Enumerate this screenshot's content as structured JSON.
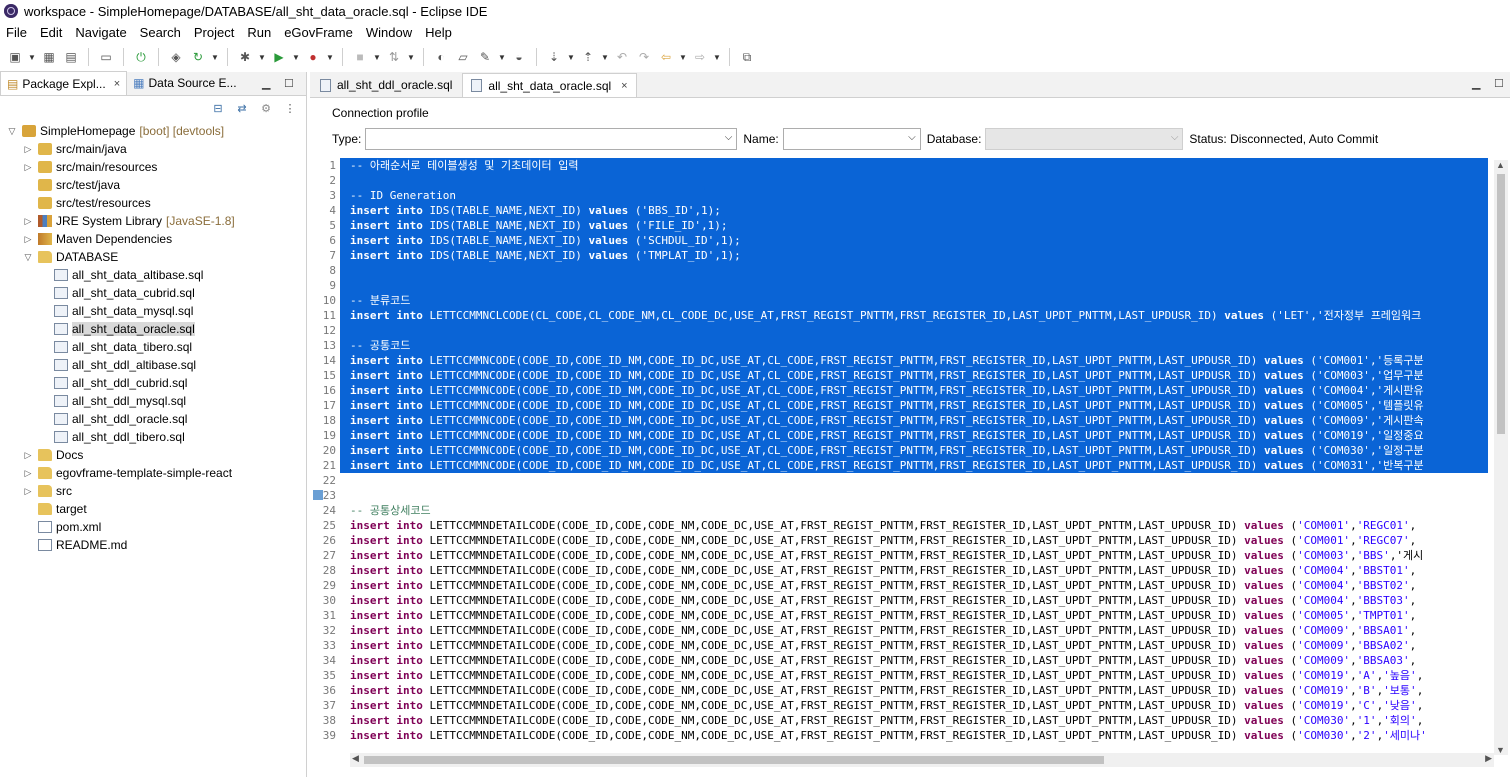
{
  "window": {
    "title": "workspace - SimpleHomepage/DATABASE/all_sht_data_oracle.sql - Eclipse IDE"
  },
  "menu": [
    "File",
    "Edit",
    "Navigate",
    "Search",
    "Project",
    "Run",
    "eGovFrame",
    "Window",
    "Help"
  ],
  "left_panel": {
    "tabs": [
      {
        "label": "Package Expl...",
        "close": "×"
      },
      {
        "label": "Data Source E..."
      }
    ],
    "tree": [
      {
        "label": "SimpleHomepage",
        "decoration": "[boot] [devtools]"
      },
      {
        "label": "src/main/java"
      },
      {
        "label": "src/main/resources"
      },
      {
        "label": "src/test/java"
      },
      {
        "label": "src/test/resources"
      },
      {
        "label": "JRE System Library",
        "decoration": "[JavaSE-1.8]"
      },
      {
        "label": "Maven Dependencies"
      },
      {
        "label": "DATABASE"
      },
      {
        "label": "all_sht_data_altibase.sql"
      },
      {
        "label": "all_sht_data_cubrid.sql"
      },
      {
        "label": "all_sht_data_mysql.sql"
      },
      {
        "label": "all_sht_data_oracle.sql"
      },
      {
        "label": "all_sht_data_tibero.sql"
      },
      {
        "label": "all_sht_ddl_altibase.sql"
      },
      {
        "label": "all_sht_ddl_cubrid.sql"
      },
      {
        "label": "all_sht_ddl_mysql.sql"
      },
      {
        "label": "all_sht_ddl_oracle.sql"
      },
      {
        "label": "all_sht_ddl_tibero.sql"
      },
      {
        "label": "Docs"
      },
      {
        "label": "egovframe-template-simple-react"
      },
      {
        "label": "src"
      },
      {
        "label": "target"
      },
      {
        "label": "pom.xml"
      },
      {
        "label": "README.md"
      }
    ]
  },
  "editor": {
    "tabs": [
      {
        "label": "all_sht_ddl_oracle.sql"
      },
      {
        "label": "all_sht_data_oracle.sql",
        "close": "×"
      }
    ],
    "connection_profile": {
      "legend": "Connection profile",
      "type_label": "Type:",
      "name_label": "Name:",
      "database_label": "Database:",
      "status": "Status: Disconnected, Auto Commit"
    },
    "lines": [
      {
        "n": "1",
        "text": "-- 아래순서로 테이블생성 및 기초데이터 입력"
      },
      {
        "n": "2",
        "text": ""
      },
      {
        "n": "3",
        "text": "-- ID Generation"
      },
      {
        "n": "4",
        "text": "insert into IDS(TABLE_NAME,NEXT_ID) values ('BBS_ID',1);"
      },
      {
        "n": "5",
        "text": "insert into IDS(TABLE_NAME,NEXT_ID) values ('FILE_ID',1);"
      },
      {
        "n": "6",
        "text": "insert into IDS(TABLE_NAME,NEXT_ID) values ('SCHDUL_ID',1);"
      },
      {
        "n": "7",
        "text": "insert into IDS(TABLE_NAME,NEXT_ID) values ('TMPLAT_ID',1);"
      },
      {
        "n": "8",
        "text": ""
      },
      {
        "n": "9",
        "text": ""
      },
      {
        "n": "10",
        "text": "-- 분류코드"
      },
      {
        "n": "11",
        "text": "insert into LETTCCMMNCLCODE(CL_CODE,CL_CODE_NM,CL_CODE_DC,USE_AT,FRST_REGIST_PNTTM,FRST_REGISTER_ID,LAST_UPDT_PNTTM,LAST_UPDUSR_ID) values ('LET','전자정부 프레임워크"
      },
      {
        "n": "12",
        "text": ""
      },
      {
        "n": "13",
        "text": "-- 공통코드"
      },
      {
        "n": "14",
        "text": "insert into LETTCCMMNCODE(CODE_ID,CODE_ID_NM,CODE_ID_DC,USE_AT,CL_CODE,FRST_REGIST_PNTTM,FRST_REGISTER_ID,LAST_UPDT_PNTTM,LAST_UPDUSR_ID) values ('COM001','등록구분"
      },
      {
        "n": "15",
        "text": "insert into LETTCCMMNCODE(CODE_ID,CODE_ID_NM,CODE_ID_DC,USE_AT,CL_CODE,FRST_REGIST_PNTTM,FRST_REGISTER_ID,LAST_UPDT_PNTTM,LAST_UPDUSR_ID) values ('COM003','업무구분"
      },
      {
        "n": "16",
        "text": "insert into LETTCCMMNCODE(CODE_ID,CODE_ID_NM,CODE_ID_DC,USE_AT,CL_CODE,FRST_REGIST_PNTTM,FRST_REGISTER_ID,LAST_UPDT_PNTTM,LAST_UPDUSR_ID) values ('COM004','게시판유"
      },
      {
        "n": "17",
        "text": "insert into LETTCCMMNCODE(CODE_ID,CODE_ID_NM,CODE_ID_DC,USE_AT,CL_CODE,FRST_REGIST_PNTTM,FRST_REGISTER_ID,LAST_UPDT_PNTTM,LAST_UPDUSR_ID) values ('COM005','템플릿유"
      },
      {
        "n": "18",
        "text": "insert into LETTCCMMNCODE(CODE_ID,CODE_ID_NM,CODE_ID_DC,USE_AT,CL_CODE,FRST_REGIST_PNTTM,FRST_REGISTER_ID,LAST_UPDT_PNTTM,LAST_UPDUSR_ID) values ('COM009','게시판속"
      },
      {
        "n": "19",
        "text": "insert into LETTCCMMNCODE(CODE_ID,CODE_ID_NM,CODE_ID_DC,USE_AT,CL_CODE,FRST_REGIST_PNTTM,FRST_REGISTER_ID,LAST_UPDT_PNTTM,LAST_UPDUSR_ID) values ('COM019','일정중요"
      },
      {
        "n": "20",
        "text": "insert into LETTCCMMNCODE(CODE_ID,CODE_ID_NM,CODE_ID_DC,USE_AT,CL_CODE,FRST_REGIST_PNTTM,FRST_REGISTER_ID,LAST_UPDT_PNTTM,LAST_UPDUSR_ID) values ('COM030','일정구분"
      },
      {
        "n": "21",
        "text": "insert into LETTCCMMNCODE(CODE_ID,CODE_ID_NM,CODE_ID_DC,USE_AT,CL_CODE,FRST_REGIST_PNTTM,FRST_REGISTER_ID,LAST_UPDT_PNTTM,LAST_UPDUSR_ID) values ('COM031','반복구분"
      },
      {
        "n": "22",
        "text": ""
      },
      {
        "n": "23",
        "text": ""
      },
      {
        "n": "24",
        "text": "-- 공통상세코드"
      },
      {
        "n": "25",
        "text": "insert into LETTCCMMNDETAILCODE(CODE_ID,CODE,CODE_NM,CODE_DC,USE_AT,FRST_REGIST_PNTTM,FRST_REGISTER_ID,LAST_UPDT_PNTTM,LAST_UPDUSR_ID) values ('COM001','REGC01',"
      },
      {
        "n": "26",
        "text": "insert into LETTCCMMNDETAILCODE(CODE_ID,CODE,CODE_NM,CODE_DC,USE_AT,FRST_REGIST_PNTTM,FRST_REGISTER_ID,LAST_UPDT_PNTTM,LAST_UPDUSR_ID) values ('COM001','REGC07',"
      },
      {
        "n": "27",
        "text": "insert into LETTCCMMNDETAILCODE(CODE_ID,CODE,CODE_NM,CODE_DC,USE_AT,FRST_REGIST_PNTTM,FRST_REGISTER_ID,LAST_UPDT_PNTTM,LAST_UPDUSR_ID) values ('COM003','BBS','게시"
      },
      {
        "n": "28",
        "text": "insert into LETTCCMMNDETAILCODE(CODE_ID,CODE,CODE_NM,CODE_DC,USE_AT,FRST_REGIST_PNTTM,FRST_REGISTER_ID,LAST_UPDT_PNTTM,LAST_UPDUSR_ID) values ('COM004','BBST01',"
      },
      {
        "n": "29",
        "text": "insert into LETTCCMMNDETAILCODE(CODE_ID,CODE,CODE_NM,CODE_DC,USE_AT,FRST_REGIST_PNTTM,FRST_REGISTER_ID,LAST_UPDT_PNTTM,LAST_UPDUSR_ID) values ('COM004','BBST02',"
      },
      {
        "n": "30",
        "text": "insert into LETTCCMMNDETAILCODE(CODE_ID,CODE,CODE_NM,CODE_DC,USE_AT,FRST_REGIST_PNTTM,FRST_REGISTER_ID,LAST_UPDT_PNTTM,LAST_UPDUSR_ID) values ('COM004','BBST03',"
      },
      {
        "n": "31",
        "text": "insert into LETTCCMMNDETAILCODE(CODE_ID,CODE,CODE_NM,CODE_DC,USE_AT,FRST_REGIST_PNTTM,FRST_REGISTER_ID,LAST_UPDT_PNTTM,LAST_UPDUSR_ID) values ('COM005','TMPT01',"
      },
      {
        "n": "32",
        "text": "insert into LETTCCMMNDETAILCODE(CODE_ID,CODE,CODE_NM,CODE_DC,USE_AT,FRST_REGIST_PNTTM,FRST_REGISTER_ID,LAST_UPDT_PNTTM,LAST_UPDUSR_ID) values ('COM009','BBSA01',"
      },
      {
        "n": "33",
        "text": "insert into LETTCCMMNDETAILCODE(CODE_ID,CODE,CODE_NM,CODE_DC,USE_AT,FRST_REGIST_PNTTM,FRST_REGISTER_ID,LAST_UPDT_PNTTM,LAST_UPDUSR_ID) values ('COM009','BBSA02',"
      },
      {
        "n": "34",
        "text": "insert into LETTCCMMNDETAILCODE(CODE_ID,CODE,CODE_NM,CODE_DC,USE_AT,FRST_REGIST_PNTTM,FRST_REGISTER_ID,LAST_UPDT_PNTTM,LAST_UPDUSR_ID) values ('COM009','BBSA03',"
      },
      {
        "n": "35",
        "text": "insert into LETTCCMMNDETAILCODE(CODE_ID,CODE,CODE_NM,CODE_DC,USE_AT,FRST_REGIST_PNTTM,FRST_REGISTER_ID,LAST_UPDT_PNTTM,LAST_UPDUSR_ID) values ('COM019','A','높음',"
      },
      {
        "n": "36",
        "text": "insert into LETTCCMMNDETAILCODE(CODE_ID,CODE,CODE_NM,CODE_DC,USE_AT,FRST_REGIST_PNTTM,FRST_REGISTER_ID,LAST_UPDT_PNTTM,LAST_UPDUSR_ID) values ('COM019','B','보통',"
      },
      {
        "n": "37",
        "text": "insert into LETTCCMMNDETAILCODE(CODE_ID,CODE,CODE_NM,CODE_DC,USE_AT,FRST_REGIST_PNTTM,FRST_REGISTER_ID,LAST_UPDT_PNTTM,LAST_UPDUSR_ID) values ('COM019','C','낮음',"
      },
      {
        "n": "38",
        "text": "insert into LETTCCMMNDETAILCODE(CODE_ID,CODE,CODE_NM,CODE_DC,USE_AT,FRST_REGIST_PNTTM,FRST_REGISTER_ID,LAST_UPDT_PNTTM,LAST_UPDUSR_ID) values ('COM030','1','회의',"
      },
      {
        "n": "39",
        "text": "insert into LETTCCMMNDETAILCODE(CODE_ID,CODE,CODE_NM,CODE_DC,USE_AT,FRST_REGIST_PNTTM,FRST_REGISTER_ID,LAST_UPDT_PNTTM,LAST_UPDUSR_ID) values ('COM030','2','세미나'"
      }
    ]
  },
  "colors": {
    "selection": "#0a64d6",
    "keyword": "#7f0055",
    "comment": "#3f7f5f",
    "string": "#2a00ff"
  }
}
